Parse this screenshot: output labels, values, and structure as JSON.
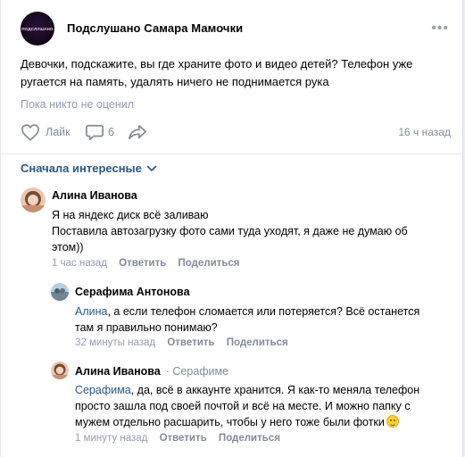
{
  "post": {
    "group_name": "Подслушано Самара Мамочки",
    "avatar_text": "подслушано",
    "text": "Девочки, подскажите, вы где храните фото и видео детей? Телефон уже ругается на память, удалять ничего не поднимается рука",
    "likes_info": "Пока никто не оценил",
    "like_label": "Лайк",
    "comments_count": "6",
    "time": "16 ч назад",
    "more_label": "•••"
  },
  "sort": {
    "label": "Сначала интересные"
  },
  "comments": [
    {
      "author": "Алина Иванова",
      "reply_to": "",
      "mention": "",
      "lines": [
        "Я на яндекс диск всё заливаю",
        "Поставила автозагрузку фото сами туда уходят, я даже не думаю об",
        "этом))"
      ],
      "time": "1 час назад",
      "reply_label": "Ответить",
      "share_label": "Поделиться"
    },
    {
      "author": "Серафима Антонова",
      "reply_to": "",
      "mention": "Алина",
      "lines": [
        ", а если телефон сломается или потеряется? Всё останется",
        "там я правильно понимаю?"
      ],
      "time": "32 минуты назад",
      "reply_label": "Ответить",
      "share_label": "Поделиться"
    },
    {
      "author": "Алина Иванова",
      "reply_to": "Серафиме",
      "mention": "Серафима",
      "lines": [
        ", да, всё в аккаунте хранится. Я как-то меняла телефон",
        "просто зашла под своей почтой и всё на месте. И можно папку с",
        "мужем отдельно расшарить, чтобы у него тоже были фотки"
      ],
      "time": "1 минуту назад",
      "reply_label": "Ответить",
      "share_label": "Поделиться"
    }
  ],
  "colors": {
    "link": "#2a5885",
    "secondary": "#818c99",
    "muted": "#939cb0"
  },
  "icons": {
    "like": "heart-outline-icon",
    "comment": "speech-bubble-icon",
    "share": "share-arrow-icon",
    "sort": "chevron-down-icon",
    "emoji": "smiling-face-emoji"
  }
}
